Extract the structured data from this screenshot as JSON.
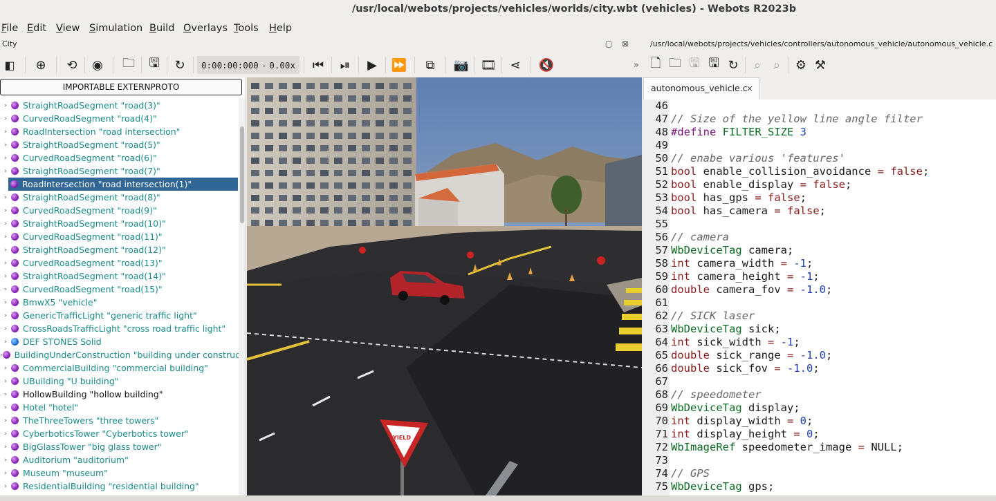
{
  "window": {
    "title": "/usr/local/webots/projects/vehicles/worlds/city.wbt (vehicles) - Webots R2023b"
  },
  "menu": [
    {
      "u": "F",
      "rest": "ile"
    },
    {
      "u": "E",
      "rest": "dit"
    },
    {
      "u": "V",
      "rest": "iew"
    },
    {
      "u": "S",
      "rest": "imulation"
    },
    {
      "u": "B",
      "rest": "uild"
    },
    {
      "u": "O",
      "rest": "verlays"
    },
    {
      "u": "T",
      "rest": "ools"
    },
    {
      "u": "H",
      "rest": "elp"
    }
  ],
  "scene_panel": {
    "title": "City"
  },
  "editor_panel": {
    "path": "/usr/local/webots/projects/vehicles/controllers/autonomous_vehicle/autonomous_vehicle.c"
  },
  "simulation": {
    "time": "0:00:00:000",
    "dash": "-",
    "speed": "0.00x"
  },
  "tree": {
    "extern_button": "IMPORTABLE EXTERNPROTO",
    "items": [
      {
        "label": "StraightRoadSegment \"road(3)\"",
        "icon": "proto-sphere-icon"
      },
      {
        "label": "CurvedRoadSegment \"road(4)\"",
        "icon": "proto-sphere-icon"
      },
      {
        "label": "RoadIntersection \"road intersection\"",
        "icon": "proto-sphere-icon"
      },
      {
        "label": "StraightRoadSegment \"road(5)\"",
        "icon": "proto-sphere-icon"
      },
      {
        "label": "CurvedRoadSegment \"road(6)\"",
        "icon": "proto-sphere-icon"
      },
      {
        "label": "StraightRoadSegment \"road(7)\"",
        "icon": "proto-sphere-icon"
      },
      {
        "label": "RoadIntersection \"road intersection(1)\"",
        "icon": "proto-sphere-icon",
        "selected": true
      },
      {
        "label": "StraightRoadSegment \"road(8)\"",
        "icon": "proto-sphere-icon"
      },
      {
        "label": "CurvedRoadSegment \"road(9)\"",
        "icon": "proto-sphere-icon"
      },
      {
        "label": "StraightRoadSegment \"road(10)\"",
        "icon": "proto-sphere-icon"
      },
      {
        "label": "CurvedRoadSegment \"road(11)\"",
        "icon": "proto-sphere-icon"
      },
      {
        "label": "StraightRoadSegment \"road(12)\"",
        "icon": "proto-sphere-icon"
      },
      {
        "label": "CurvedRoadSegment \"road(13)\"",
        "icon": "proto-sphere-icon"
      },
      {
        "label": "StraightRoadSegment \"road(14)\"",
        "icon": "proto-sphere-icon"
      },
      {
        "label": "CurvedRoadSegment \"road(15)\"",
        "icon": "proto-sphere-icon"
      },
      {
        "label": "BmwX5 \"vehicle\"",
        "icon": "proto-sphere-icon"
      },
      {
        "label": "GenericTrafficLight \"generic traffic light\"",
        "icon": "proto-sphere-icon"
      },
      {
        "label": "CrossRoadsTrafficLight \"cross road traffic light\"",
        "icon": "proto-sphere-icon"
      },
      {
        "label": "DEF STONES Solid",
        "icon": "solid-sphere-icon",
        "blue": true
      },
      {
        "label": "BuildingUnderConstruction \"building under construction\"",
        "icon": "proto-sphere-icon"
      },
      {
        "label": "CommercialBuilding \"commercial building\"",
        "icon": "proto-sphere-icon"
      },
      {
        "label": "UBuilding \"U building\"",
        "icon": "proto-sphere-icon"
      },
      {
        "label": "HollowBuilding \"hollow building\"",
        "icon": "proto-sphere-icon",
        "dark": true
      },
      {
        "label": "Hotel \"hotel\"",
        "icon": "proto-sphere-icon"
      },
      {
        "label": "TheThreeTowers \"three towers\"",
        "icon": "proto-sphere-icon"
      },
      {
        "label": "CyberboticsTower \"Cyberbotics tower\"",
        "icon": "proto-sphere-icon"
      },
      {
        "label": "BigGlassTower \"big glass tower\"",
        "icon": "proto-sphere-icon"
      },
      {
        "label": "Auditorium \"auditorium\"",
        "icon": "proto-sphere-icon"
      },
      {
        "label": "Museum \"museum\"",
        "icon": "proto-sphere-icon"
      },
      {
        "label": "ResidentialBuilding \"residential building\"",
        "icon": "proto-sphere-icon"
      }
    ]
  },
  "editor": {
    "tab_label": "autonomous_vehicle.c",
    "tab_close": "×",
    "lines": [
      {
        "n": "46",
        "t": ""
      },
      {
        "n": "47",
        "t": "// Size of the yellow line angle filter"
      },
      {
        "n": "48",
        "t": "#define FILTER_SIZE 3"
      },
      {
        "n": "49",
        "t": ""
      },
      {
        "n": "50",
        "t": "// enabe various 'features'"
      },
      {
        "n": "51",
        "t": "bool enable_collision_avoidance = false;"
      },
      {
        "n": "52",
        "t": "bool enable_display = false;"
      },
      {
        "n": "53",
        "t": "bool has_gps = false;"
      },
      {
        "n": "54",
        "t": "bool has_camera = false;"
      },
      {
        "n": "55",
        "t": ""
      },
      {
        "n": "56",
        "t": "// camera"
      },
      {
        "n": "57",
        "t": "WbDeviceTag camera;"
      },
      {
        "n": "58",
        "t": "int camera_width = -1;"
      },
      {
        "n": "59",
        "t": "int camera_height = -1;"
      },
      {
        "n": "60",
        "t": "double camera_fov = -1.0;"
      },
      {
        "n": "61",
        "t": ""
      },
      {
        "n": "62",
        "t": "// SICK laser"
      },
      {
        "n": "63",
        "t": "WbDeviceTag sick;"
      },
      {
        "n": "64",
        "t": "int sick_width = -1;"
      },
      {
        "n": "65",
        "t": "double sick_range = -1.0;"
      },
      {
        "n": "66",
        "t": "double sick_fov = -1.0;"
      },
      {
        "n": "67",
        "t": ""
      },
      {
        "n": "68",
        "t": "// speedometer"
      },
      {
        "n": "69",
        "t": "WbDeviceTag display;"
      },
      {
        "n": "70",
        "t": "int display_width = 0;"
      },
      {
        "n": "71",
        "t": "int display_height = 0;"
      },
      {
        "n": "72",
        "t": "WbImageRef speedometer_image = NULL;"
      },
      {
        "n": "73",
        "t": ""
      },
      {
        "n": "74",
        "t": "// GPS"
      },
      {
        "n": "75",
        "t": "WbDeviceTag gps;"
      }
    ]
  },
  "scene3d": {
    "sign_text": "YIELD"
  },
  "colors": {
    "selection": "#2f6695",
    "tree_text": "#1b8a8a",
    "proto_icon": "#8a23b8",
    "solid_icon": "#1f6fe0"
  }
}
